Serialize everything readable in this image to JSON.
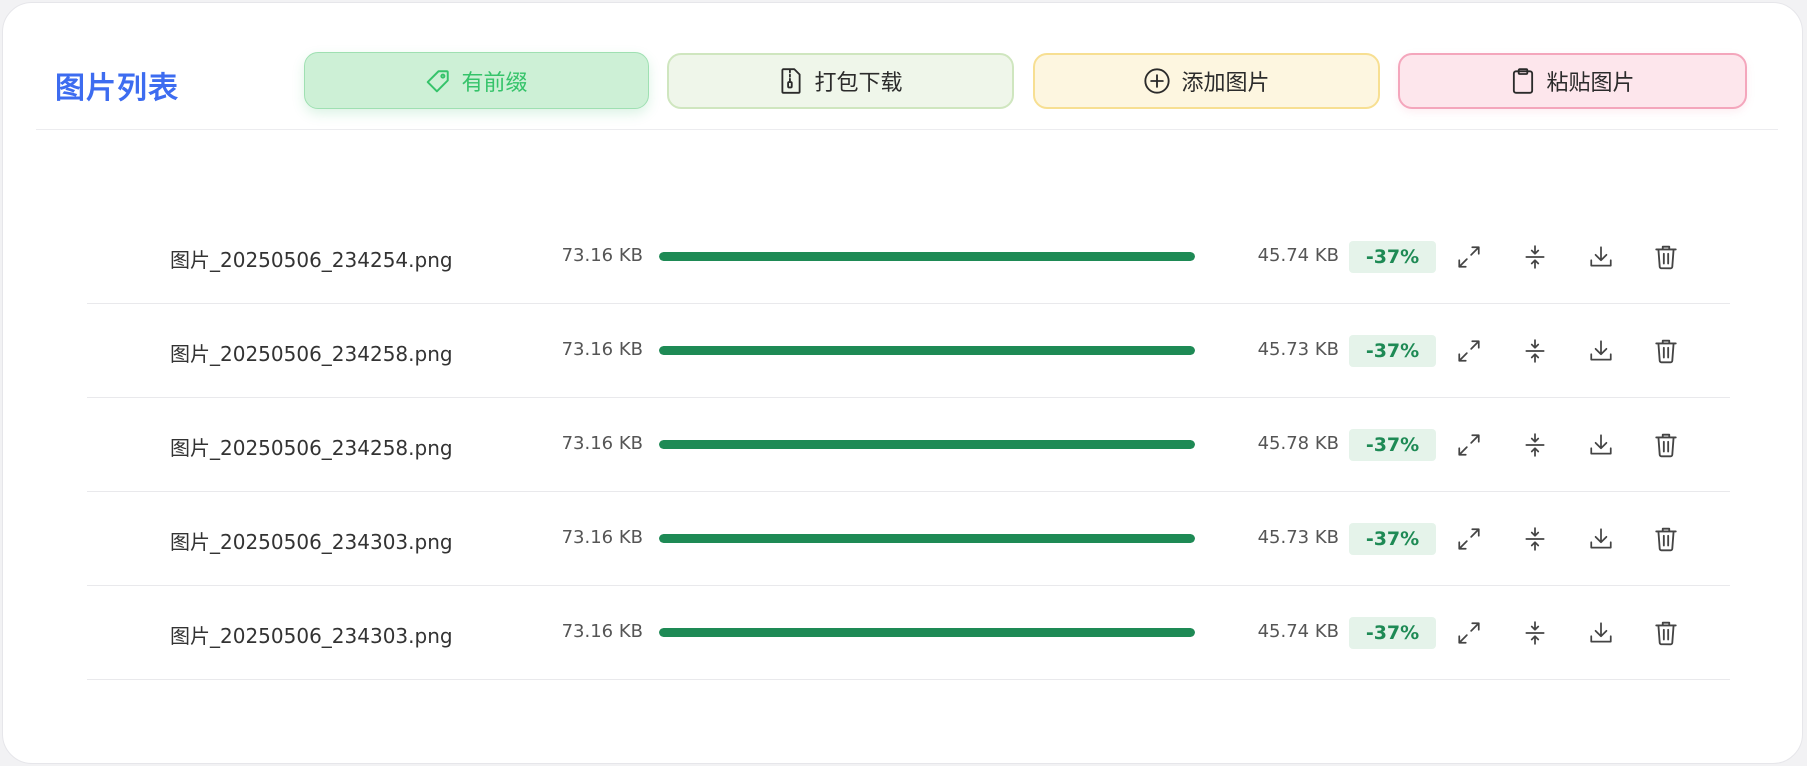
{
  "header": {
    "title": "图片列表",
    "buttons": {
      "prefix": "有前缀",
      "zip_download": "打包下载",
      "add_image": "添加图片",
      "paste_image": "粘贴图片"
    }
  },
  "colors": {
    "title": "#3d6cf0",
    "progress": "#1e8a55",
    "badge_text": "#1e8a55",
    "badge_bg": "#e5f3ea"
  },
  "files": [
    {
      "name": "图片_20250506_234254.png",
      "original_size": "73.16 KB",
      "progress": 1.0,
      "compressed_size": "45.74 KB",
      "reduction": "-37%"
    },
    {
      "name": "图片_20250506_234258.png",
      "original_size": "73.16 KB",
      "progress": 1.0,
      "compressed_size": "45.73 KB",
      "reduction": "-37%"
    },
    {
      "name": "图片_20250506_234258.png",
      "original_size": "73.16 KB",
      "progress": 1.0,
      "compressed_size": "45.78 KB",
      "reduction": "-37%"
    },
    {
      "name": "图片_20250506_234303.png",
      "original_size": "73.16 KB",
      "progress": 1.0,
      "compressed_size": "45.73 KB",
      "reduction": "-37%"
    },
    {
      "name": "图片_20250506_234303.png",
      "original_size": "73.16 KB",
      "progress": 1.0,
      "compressed_size": "45.74 KB",
      "reduction": "-37%"
    }
  ],
  "row_icons": [
    "expand-icon",
    "compress-icon",
    "download-icon",
    "trash-icon"
  ]
}
